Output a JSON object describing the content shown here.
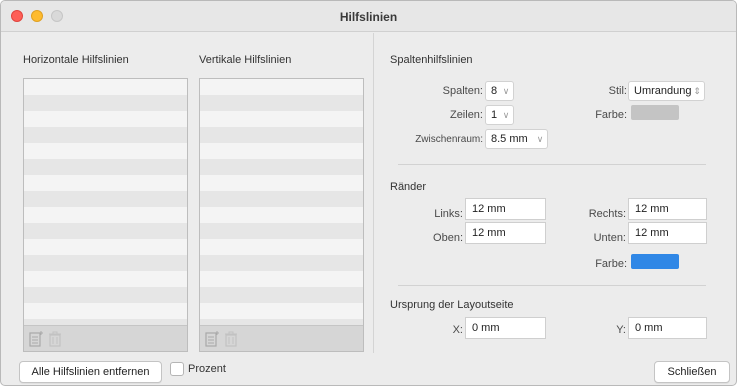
{
  "window": {
    "title": "Hilfslinien"
  },
  "lists": {
    "horizontal_label": "Horizontale Hilfslinien",
    "vertical_label": "Vertikale Hilfslinien",
    "add_icon": "add-guide-icon",
    "delete_icon": "trash-icon"
  },
  "columns": {
    "title": "Spaltenhilfslinien",
    "spalten_label": "Spalten:",
    "spalten_value": "8",
    "zeilen_label": "Zeilen:",
    "zeilen_value": "1",
    "zwischenraum_label": "Zwischenraum:",
    "zwischenraum_value": "8.5 mm",
    "stil_label": "Stil:",
    "stil_value": "Umrandung",
    "farbe_label": "Farbe:",
    "farbe_color": "#c4c4c4"
  },
  "margins": {
    "title": "Ränder",
    "links_label": "Links:",
    "links_value": "12 mm",
    "rechts_label": "Rechts:",
    "rechts_value": "12 mm",
    "oben_label": "Oben:",
    "oben_value": "12 mm",
    "unten_label": "Unten:",
    "unten_value": "12 mm",
    "farbe_label": "Farbe:",
    "farbe_color": "#2f87e6"
  },
  "origin": {
    "title": "Ursprung der Layoutseite",
    "x_label": "X:",
    "x_value": "0 mm",
    "y_label": "Y:",
    "y_value": "0 mm"
  },
  "footer": {
    "remove_all_label": "Alle Hilfslinien entfernen",
    "percent_label": "Prozent",
    "percent_checked": false,
    "close_label": "Schließen"
  }
}
